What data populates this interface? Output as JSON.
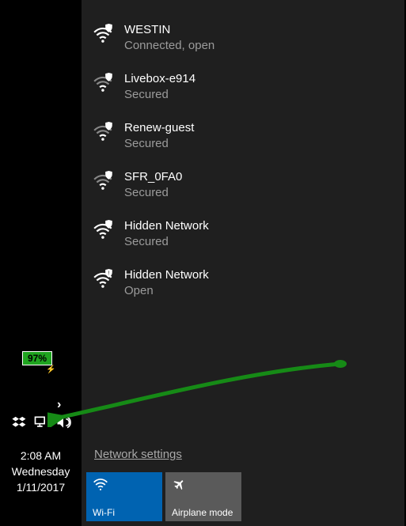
{
  "networks": [
    {
      "name": "WESTIN",
      "status": "Connected, open",
      "signal": "full",
      "secured": false,
      "connected": true
    },
    {
      "name": "Livebox-e914",
      "status": "Secured",
      "signal": "low",
      "secured": true,
      "connected": false
    },
    {
      "name": "Renew-guest",
      "status": "Secured",
      "signal": "low",
      "secured": true,
      "connected": false
    },
    {
      "name": "SFR_0FA0",
      "status": "Secured",
      "signal": "low",
      "secured": true,
      "connected": false
    },
    {
      "name": "Hidden Network",
      "status": "Secured",
      "signal": "full",
      "secured": true,
      "connected": false
    },
    {
      "name": "Hidden Network",
      "status": "Open",
      "signal": "full",
      "secured": false,
      "connected": false
    }
  ],
  "settings_link": "Network settings",
  "tiles": {
    "wifi": "Wi-Fi",
    "airplane": "Airplane mode"
  },
  "battery": {
    "percent": "97%"
  },
  "clock": {
    "time": "2:08 AM",
    "day": "Wednesday",
    "date": "1/11/2017"
  }
}
